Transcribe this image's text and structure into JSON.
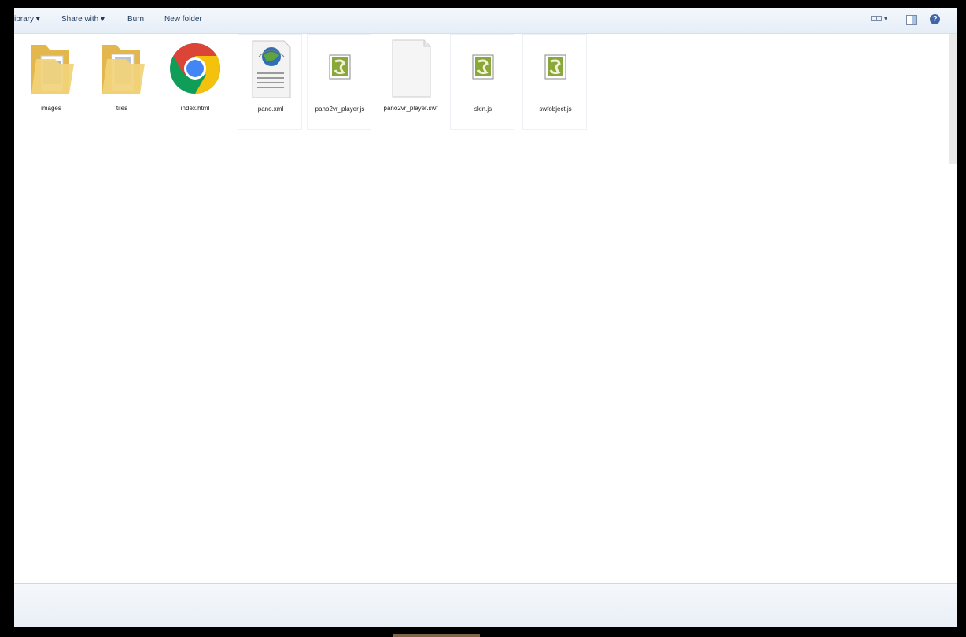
{
  "toolbar": {
    "library_label": "ibrary ▾",
    "share_label": "Share with ▾",
    "burn_label": "Burn",
    "new_folder_label": "New folder"
  },
  "icons": {
    "view": "view-options-icon",
    "pane": "preview-pane-icon",
    "help": "help-icon"
  },
  "files": [
    {
      "name": "images",
      "type": "folder"
    },
    {
      "name": "tiles",
      "type": "folder"
    },
    {
      "name": "index.html",
      "type": "chrome-html"
    },
    {
      "name": "pano.xml",
      "type": "xml"
    },
    {
      "name": "pano2vr_player.js",
      "type": "js"
    },
    {
      "name": "pano2vr_player.swf",
      "type": "blank"
    },
    {
      "name": "skin.js",
      "type": "js"
    },
    {
      "name": "swfobject.js",
      "type": "js"
    }
  ],
  "colors": {
    "folder": "#f2d27a",
    "folder_dark": "#e4b74e",
    "chrome_red": "#db4437",
    "chrome_yellow": "#f4c20d",
    "chrome_green": "#0f9d58",
    "chrome_blue": "#4285f4",
    "js_green": "#8aa83a"
  }
}
